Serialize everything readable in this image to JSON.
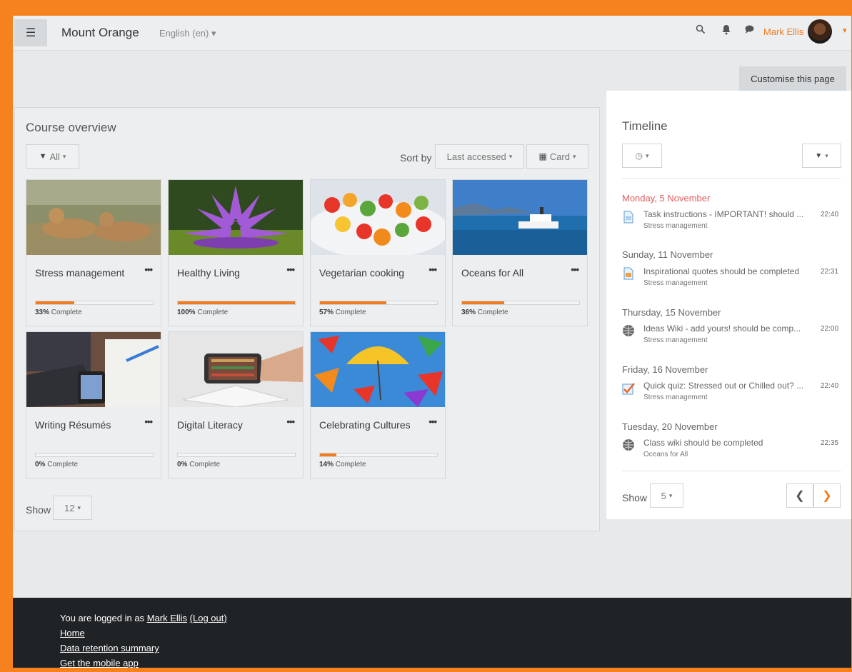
{
  "navbar": {
    "site_name": "Mount Orange",
    "language": "English (en)",
    "user_name": "Mark Ellis",
    "icons": [
      "hamburger-icon",
      "search-icon",
      "bell-icon",
      "chat-icon",
      "caret-down-icon"
    ]
  },
  "customise_label": "Customise this page",
  "course_overview": {
    "title": "Course overview",
    "filter_label": "All",
    "sort_label": "Sort by",
    "sort_value": "Last accessed",
    "view_value": "Card",
    "show_label": "Show",
    "show_value": "12",
    "courses": [
      {
        "name": "Stress management",
        "progress": 33,
        "progress_pct": "33%",
        "complete_label": "Complete"
      },
      {
        "name": "Healthy Living",
        "progress": 100,
        "progress_pct": "100%",
        "complete_label": "Complete"
      },
      {
        "name": "Vegetarian cooking",
        "progress": 57,
        "progress_pct": "57%",
        "complete_label": "Complete"
      },
      {
        "name": "Oceans for All",
        "progress": 36,
        "progress_pct": "36%",
        "complete_label": "Complete"
      },
      {
        "name": "Writing Résumés",
        "progress": 0,
        "progress_pct": "0%",
        "complete_label": "Complete"
      },
      {
        "name": "Digital Literacy",
        "progress": 0,
        "progress_pct": "0%",
        "complete_label": "Complete"
      },
      {
        "name": "Celebrating Cultures",
        "progress": 14,
        "progress_pct": "14%",
        "complete_label": "Complete"
      }
    ]
  },
  "timeline": {
    "title": "Timeline",
    "show_label": "Show",
    "show_value": "5",
    "events": [
      {
        "day": "Monday, 5 November",
        "title": "Task instructions - IMPORTANT! should ...",
        "course": "Stress management",
        "time": "22:40",
        "icon": "document-icon"
      },
      {
        "day": "Sunday, 11 November",
        "title": "Inspirational quotes should be completed",
        "course": "Stress management",
        "time": "22:31",
        "icon": "assignment-icon"
      },
      {
        "day": "Thursday, 15 November",
        "title": "Ideas Wiki - add yours! should be comp...",
        "course": "Stress management",
        "time": "22:00",
        "icon": "wiki-icon"
      },
      {
        "day": "Friday, 16 November",
        "title": "Quick quiz: Stressed out or Chilled out? ...",
        "course": "Stress management",
        "time": "22:40",
        "icon": "quiz-icon"
      },
      {
        "day": "Tuesday, 20 November",
        "title": "Class wiki should be completed",
        "course": "Oceans for All",
        "time": "22:35",
        "icon": "wiki-icon"
      }
    ]
  },
  "footer": {
    "logged_in_prefix": "You are logged in as",
    "user_name": "Mark Ellis",
    "logout_label": "(Log out)",
    "links": [
      "Home",
      "Data retention summary",
      "Get the mobile app"
    ]
  },
  "colors": {
    "accent": "#f07c21",
    "frame": "#f5821f",
    "footer": "#1f2326",
    "today": "#e35b5b"
  }
}
